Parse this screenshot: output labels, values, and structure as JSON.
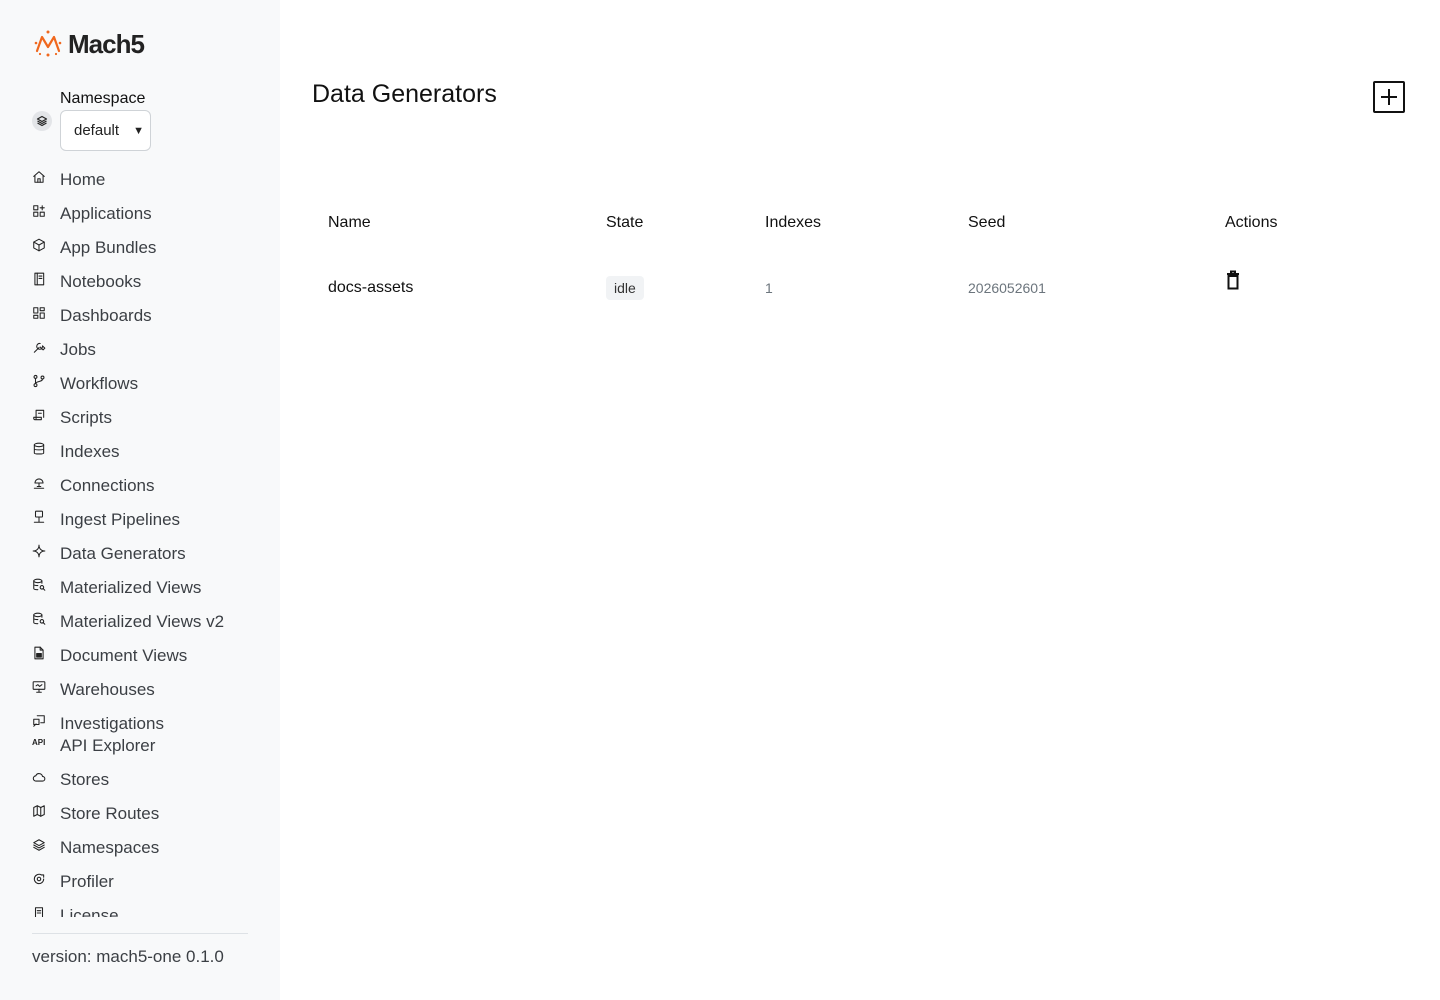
{
  "app": {
    "logo_text": "Mach5",
    "brand_color": "#f0681e"
  },
  "sidebar": {
    "namespace_label": "Namespace",
    "namespace_value": "default",
    "items": [
      {
        "label": "Home",
        "icon": "home-icon"
      },
      {
        "label": "Applications",
        "icon": "apps-icon"
      },
      {
        "label": "App Bundles",
        "icon": "package-icon"
      },
      {
        "label": "Notebooks",
        "icon": "notebook-icon"
      },
      {
        "label": "Dashboards",
        "icon": "dashboard-icon"
      },
      {
        "label": "Jobs",
        "icon": "wrench-icon"
      },
      {
        "label": "Workflows",
        "icon": "git-branch-icon"
      },
      {
        "label": "Scripts",
        "icon": "script-icon"
      },
      {
        "label": "Indexes",
        "icon": "database-icon"
      },
      {
        "label": "Connections",
        "icon": "satellite-icon"
      },
      {
        "label": "Ingest Pipelines",
        "icon": "pipeline-icon"
      },
      {
        "label": "Data Generators",
        "icon": "sparkle-icon"
      },
      {
        "label": "Materialized Views",
        "icon": "database-search-icon"
      },
      {
        "label": "Materialized Views v2",
        "icon": "database-search-icon"
      },
      {
        "label": "Document Views",
        "icon": "file-icon"
      },
      {
        "label": "Warehouses",
        "icon": "monitor-icon"
      },
      {
        "label": "Investigations",
        "icon": "investigation-icon"
      },
      {
        "label": "API Explorer",
        "icon": "api-icon"
      },
      {
        "label": "Stores",
        "icon": "cloud-icon"
      },
      {
        "label": "Store Routes",
        "icon": "map-icon"
      },
      {
        "label": "Namespaces",
        "icon": "stack-icon"
      },
      {
        "label": "Profiler",
        "icon": "profiler-icon"
      },
      {
        "label": "License",
        "icon": "license-icon"
      }
    ],
    "version": "version: mach5-one 0.1.0"
  },
  "main": {
    "title": "Data Generators",
    "table": {
      "headers": [
        "Name",
        "State",
        "Indexes",
        "Seed",
        "Actions"
      ],
      "rows": [
        {
          "name": "docs-assets",
          "state": "idle",
          "indexes": "1",
          "seed": "2026052601"
        }
      ]
    }
  }
}
